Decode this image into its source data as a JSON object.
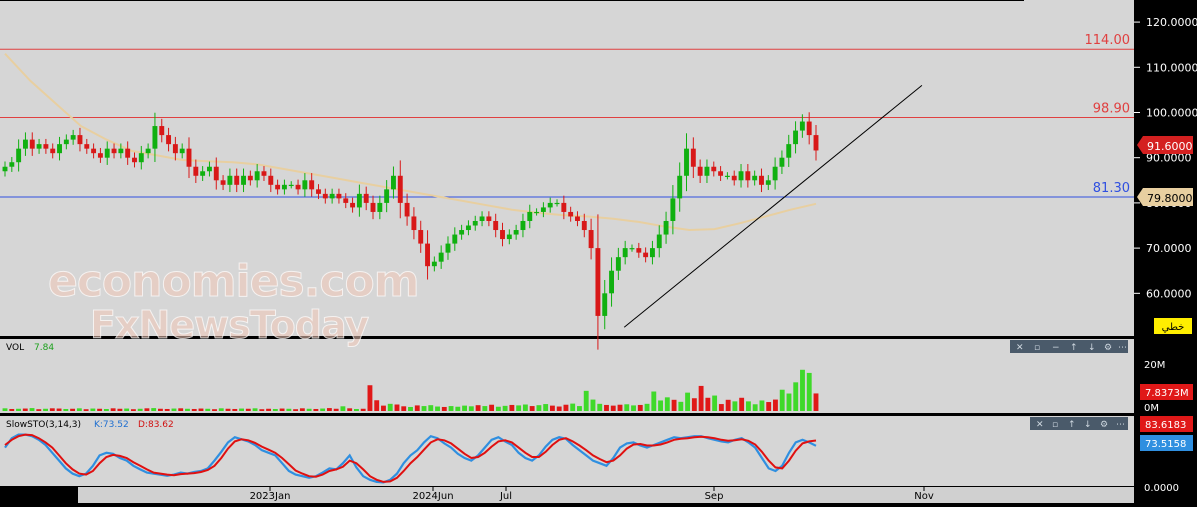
{
  "watermark": {
    "line1": "economies.com",
    "line2": "FxNewsToday"
  },
  "chart_data": [
    {
      "type": "candlestick",
      "x_ticks": [
        "2023Jan",
        "2024Jun",
        "Jul",
        "Sep",
        "Nov"
      ],
      "y_ticks": [
        "120.0000",
        "110.0000",
        "100.0000",
        "90.0000",
        "80.0000",
        "70.0000",
        "60.0000"
      ],
      "ylim": [
        51,
        124
      ],
      "grid": false,
      "horizontal_levels": [
        {
          "label": "114.00",
          "value": 114.0,
          "color": "#e04040"
        },
        {
          "label": "98.90",
          "value": 98.9,
          "color": "#e04040"
        },
        {
          "label": "81.30",
          "value": 81.3,
          "color": "#3050e0"
        }
      ],
      "last_price": {
        "label": "91.6000",
        "value": 91.6,
        "color": "#d02020"
      },
      "moving_average": {
        "label": "79.8000",
        "value": 79.8,
        "color": "#e8cfa0",
        "points": [
          113,
          107,
          102,
          97,
          94,
          91.5,
          90.5,
          89.5,
          89.2,
          89,
          88.5,
          87.5,
          86.5,
          85.5,
          84.5,
          83.5,
          82.5,
          81.5,
          80.5,
          79.5,
          78.5,
          77.8,
          77.3,
          77,
          76.5,
          75.8,
          74.8,
          74,
          74.2,
          75.5,
          77,
          78.5,
          79.8
        ]
      },
      "trendline": {
        "from": [
          0.5215,
          52.5
        ],
        "to": [
          0.7702,
          106
        ],
        "color": "#000000"
      },
      "button_label": "خطي",
      "closes": [
        88,
        89,
        92,
        94,
        92,
        93,
        92,
        91,
        93,
        94,
        95,
        93,
        92,
        91,
        90,
        92,
        91,
        92,
        90,
        89,
        91,
        92,
        97,
        95,
        93,
        91,
        92,
        88,
        86,
        87,
        88,
        85,
        84,
        86,
        84,
        86,
        85,
        87,
        86,
        84,
        83,
        84,
        84,
        83,
        85,
        83,
        82,
        81,
        82,
        81,
        80,
        79,
        82,
        80,
        78,
        80,
        83,
        86,
        80,
        77,
        74,
        71,
        66,
        67,
        69,
        71,
        73,
        74,
        75,
        76,
        77,
        76,
        74,
        72,
        73,
        74,
        76,
        78,
        78,
        79,
        80,
        80,
        78,
        77,
        76,
        74,
        70,
        55,
        60,
        65,
        68,
        70,
        70,
        69,
        68,
        70,
        73,
        76,
        81,
        86,
        92,
        88,
        86,
        88,
        87,
        86,
        86,
        85,
        87,
        85,
        86,
        84,
        85,
        88,
        90,
        93,
        96,
        98,
        95,
        91.6
      ],
      "last_bar_up": false
    },
    {
      "type": "bar",
      "title": "VOL",
      "value_text": "7.84",
      "y_ticks": [
        "20M",
        "0M"
      ],
      "last_label": "7.8373M",
      "ylim": [
        0,
        25
      ],
      "values": [
        1.2,
        0.9,
        1.0,
        1.1,
        1.3,
        0.8,
        1.0,
        1.2,
        1.1,
        0.9,
        1.0,
        1.2,
        0.8,
        1.1,
        1.0,
        0.9,
        1.2,
        1.0,
        1.1,
        0.8,
        1.0,
        1.2,
        1.3,
        1.0,
        0.9,
        1.1,
        1.2,
        1.0,
        0.9,
        1.1,
        1.0,
        0.8,
        1.2,
        1.0,
        0.9,
        1.1,
        1.0,
        1.2,
        0.8,
        1.0,
        0.9,
        1.1,
        1.0,
        0.8,
        1.2,
        1.0,
        0.9,
        1.1,
        1.3,
        1.0,
        2.1,
        1.2,
        0.9,
        1.0,
        11.5,
        4.8,
        2.4,
        3.2,
        2.9,
        2.1,
        1.8,
        2.5,
        2.2,
        2.6,
        2.0,
        1.8,
        2.2,
        1.9,
        2.4,
        2.1,
        2.6,
        2.2,
        2.8,
        1.9,
        2.3,
        2.7,
        2.5,
        2.9,
        2.2,
        2.6,
        3.1,
        2.4,
        2.0,
        2.8,
        3.3,
        2.2,
        9.0,
        5.1,
        3.2,
        2.7,
        2.4,
        2.8,
        3.0,
        2.5,
        2.7,
        3.2,
        8.7,
        4.7,
        6.1,
        5.0,
        4.1,
        8.2,
        5.7,
        11.2,
        5.9,
        6.9,
        3.1,
        5.0,
        4.3,
        5.9,
        4.3,
        3.0,
        4.7,
        4.0,
        5.1,
        9.5,
        7.8,
        12.8,
        18.4,
        17.0,
        7.84
      ],
      "up": [
        1,
        0,
        1,
        0,
        1,
        0,
        1,
        0,
        0,
        1,
        0,
        1,
        0,
        1,
        0,
        1,
        0,
        0,
        1,
        0,
        1,
        0,
        1,
        0,
        0,
        1,
        0,
        1,
        0,
        0,
        1,
        0,
        1,
        0,
        0,
        1,
        0,
        1,
        0,
        0,
        1,
        0,
        1,
        0,
        0,
        1,
        0,
        1,
        0,
        0,
        1,
        0,
        1,
        0,
        0,
        0,
        0,
        1,
        0,
        0,
        1,
        0,
        1,
        1,
        1,
        0,
        1,
        1,
        1,
        1,
        0,
        1,
        0,
        1,
        1,
        0,
        1,
        1,
        0,
        1,
        1,
        0,
        0,
        0,
        1,
        1,
        1,
        1,
        1,
        0,
        0,
        0,
        1,
        1,
        0,
        1,
        1,
        1,
        1,
        0,
        1,
        1,
        0,
        0,
        0,
        1,
        0,
        0,
        1,
        0,
        1,
        1,
        1,
        0,
        0,
        1,
        1,
        1,
        1,
        1,
        0
      ]
    },
    {
      "type": "line",
      "title": "SlowSTO(3,14,3)",
      "k_text": "K:73.52",
      "d_text": "D:83.62",
      "y_ticks": [
        "0.0000"
      ],
      "ylim": [
        0,
        100
      ],
      "series": [
        {
          "name": "K",
          "color": "#2f8fe0",
          "last_label": "73.5158",
          "values": [
            70,
            88,
            95,
            95,
            92,
            85,
            75,
            60,
            45,
            30,
            20,
            15,
            20,
            35,
            55,
            60,
            58,
            50,
            45,
            35,
            28,
            22,
            20,
            18,
            16,
            18,
            22,
            20,
            23,
            25,
            30,
            45,
            62,
            80,
            90,
            86,
            82,
            75,
            65,
            60,
            55,
            40,
            25,
            18,
            15,
            12,
            15,
            22,
            30,
            28,
            40,
            55,
            32,
            15,
            8,
            4,
            3,
            8,
            20,
            40,
            55,
            65,
            80,
            92,
            88,
            78,
            70,
            58,
            50,
            45,
            55,
            70,
            85,
            90,
            82,
            75,
            60,
            50,
            45,
            55,
            72,
            85,
            90,
            87,
            75,
            65,
            55,
            45,
            40,
            35,
            50,
            70,
            78,
            80,
            74,
            70,
            75,
            80,
            85,
            90,
            88,
            90,
            92,
            92,
            88,
            85,
            82,
            80,
            85,
            88,
            80,
            70,
            50,
            30,
            25,
            35,
            60,
            80,
            85,
            80,
            73.5
          ]
        },
        {
          "name": "D",
          "color": "#e01010",
          "last_label": "83.6183",
          "values": [
            75,
            85,
            92,
            95,
            94,
            88,
            80,
            70,
            55,
            40,
            28,
            20,
            18,
            25,
            40,
            52,
            56,
            54,
            50,
            42,
            35,
            28,
            22,
            20,
            18,
            17,
            19,
            20,
            21,
            23,
            27,
            35,
            50,
            68,
            82,
            86,
            84,
            79,
            72,
            66,
            60,
            50,
            38,
            26,
            20,
            15,
            14,
            18,
            25,
            28,
            33,
            45,
            40,
            28,
            15,
            8,
            4,
            5,
            12,
            25,
            40,
            52,
            66,
            80,
            86,
            84,
            78,
            68,
            58,
            50,
            52,
            60,
            72,
            82,
            84,
            80,
            70,
            60,
            52,
            52,
            62,
            75,
            85,
            88,
            82,
            74,
            65,
            55,
            48,
            42,
            45,
            55,
            68,
            76,
            77,
            74,
            74,
            76,
            80,
            85,
            87,
            88,
            90,
            91,
            90,
            88,
            85,
            83,
            84,
            86,
            83,
            76,
            62,
            45,
            32,
            30,
            45,
            64,
            78,
            82,
            83.6
          ]
        }
      ]
    }
  ]
}
